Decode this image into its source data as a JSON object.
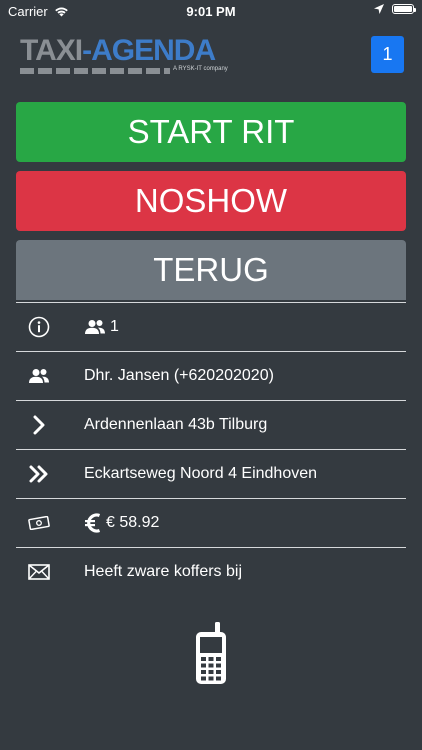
{
  "status_bar": {
    "carrier": "Carrier",
    "time": "9:01 PM"
  },
  "header": {
    "logo_taxi": "TAXI",
    "logo_dash": "-",
    "logo_agenda": "AGENDA",
    "logo_tagline": "A RYSK-IT company",
    "badge_count": "1"
  },
  "actions": {
    "start": "START RIT",
    "noshow": "NOSHOW",
    "back": "TERUG"
  },
  "details": {
    "passengers": "1",
    "customer": "Dhr. Jansen (+620202020)",
    "pickup": "Ardennenlaan 43b Tilburg",
    "destination": "Eckartseweg Noord 4 Eindhoven",
    "price": "€ 58.92",
    "note": "Heeft zware koffers bij"
  },
  "colors": {
    "background": "#343a40",
    "start": "#28a745",
    "noshow": "#dc3545",
    "back": "#6c757d",
    "badge": "#1877f2"
  }
}
